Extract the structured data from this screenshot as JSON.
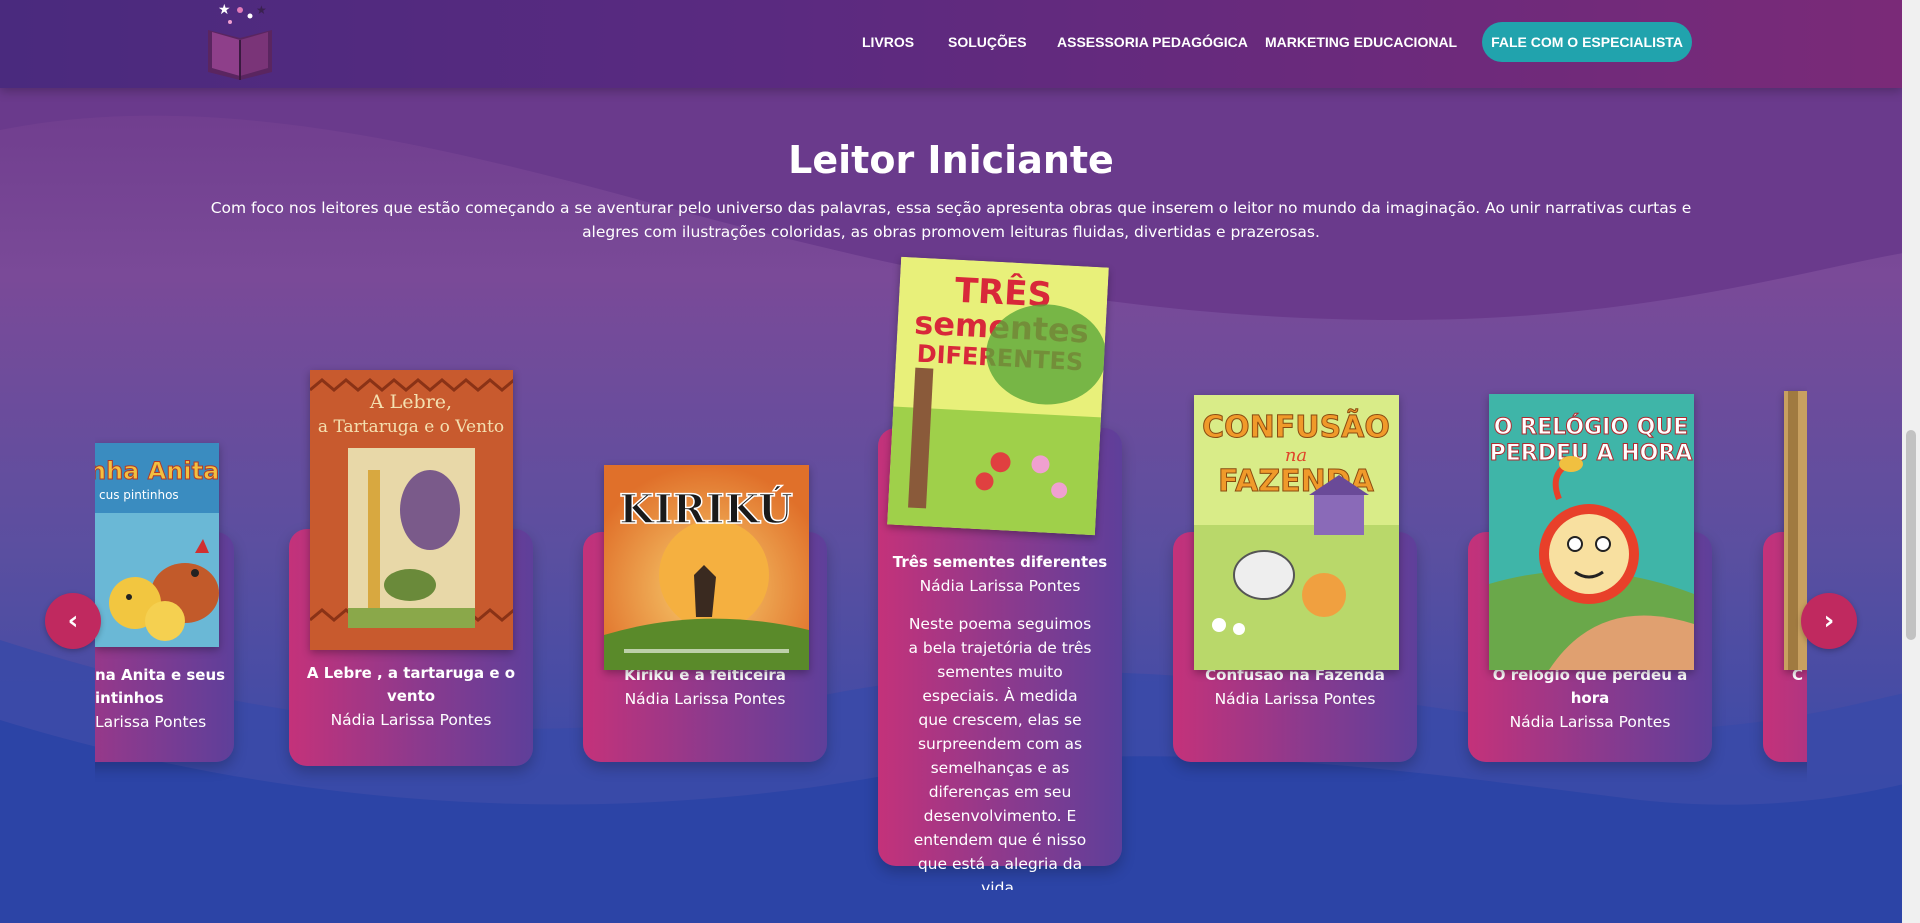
{
  "nav": {
    "items": [
      "LIVROS",
      "SOLUÇÕES",
      "ASSESSORIA PEDAGÓGICA",
      "MARKETING EDUCACIONAL"
    ],
    "cta": "FALE COM O ESPECIALISTA"
  },
  "section": {
    "title": "Leitor Iniciante",
    "description": "Com foco nos leitores que estão começando a se aventurar pelo universo das palavras, essa seção apresenta obras que inserem o leitor no mundo da imaginação. Ao unir narrativas curtas e alegres com ilustrações coloridas, as obras promovem leituras fluidas, divertidas e prazerosas."
  },
  "books": [
    {
      "title": "Dona Anita e seus pintinhos",
      "title_visible": "na Anita e seus\nintinhos",
      "author": "Larissa Pontes",
      "cover_text": "nha Anita\ncus pintinhos",
      "cover_color": "#6ab8d6"
    },
    {
      "title": "A Lebre , a tartaruga e o vento",
      "author": "Nádia Larissa Pontes",
      "cover_text": "A Lebre,\na Tartaruga e o Vento",
      "cover_color": "#c85a2e"
    },
    {
      "title": "Kirikú e a feiticeira",
      "author": "Nádia Larissa Pontes",
      "cover_text": "KIRIKÚ",
      "cover_color": "#e8902e"
    },
    {
      "title": "Três sementes diferentes",
      "author": "Nádia Larissa Pontes",
      "cover_text": "TRÊS\nsementes\nDIFERENTES",
      "cover_color": "#9fd04a",
      "description": "Neste poema seguimos a bela trajetória de três sementes muito especiais. À medida que crescem, elas se surpreendem com as semelhanças e as diferenças em seu desenvolvimento. E entendem que é nisso que está a alegria da vida."
    },
    {
      "title": "Confusão na Fazenda",
      "author": "Nádia Larissa Pontes",
      "cover_text": "CONFUSÃO\nna\nFAZENDA",
      "cover_color": "#b9d86a"
    },
    {
      "title": "O relógio que perdeu a hora",
      "author": "Nádia Larissa Pontes",
      "cover_text": "O RELÓGIO QUE\nPERDEU A HORA",
      "cover_color": "#3fb5a8"
    },
    {
      "title": "",
      "title_visible": "C",
      "author": "",
      "cover_text": "",
      "cover_color": "#c8a060"
    }
  ],
  "controls": {
    "prev_icon": "chevron-left-icon",
    "next_icon": "chevron-right-icon",
    "prev_glyph": "‹",
    "next_glyph": "›"
  }
}
